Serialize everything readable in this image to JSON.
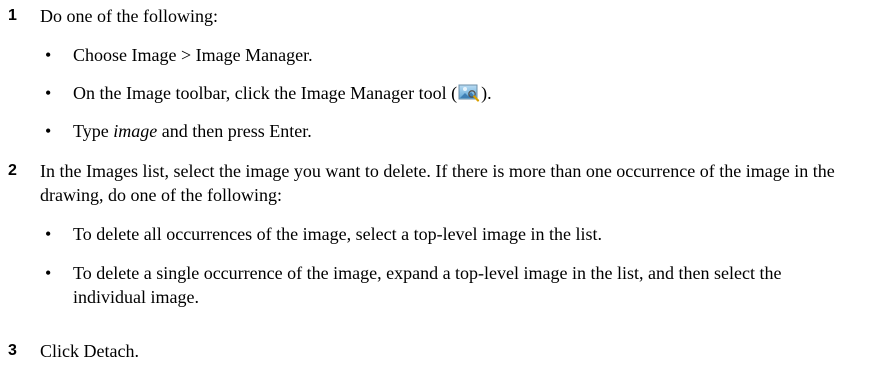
{
  "steps": [
    {
      "number": "1",
      "text": "Do one of the following:",
      "bullets": [
        {
          "text": "Choose Image > Image Manager."
        },
        {
          "before": "On the Image toolbar, click the Image Manager tool (",
          "icon": "image-manager-tool-icon",
          "after": ")."
        },
        {
          "before": "Type ",
          "italic": "image",
          "after": " and then press Enter."
        }
      ]
    },
    {
      "number": "2",
      "text": "In the Images list, select the image you want to delete. If there is more than one occurrence of the image in the drawing, do one of the following:",
      "bullets": [
        {
          "text": "To delete all occurrences of the image, select a top-level image in the list."
        },
        {
          "text": "To delete a single occurrence of the image, expand a top-level image in the list, and then select the individual image."
        }
      ]
    },
    {
      "number": "3",
      "text": "Click Detach."
    }
  ]
}
